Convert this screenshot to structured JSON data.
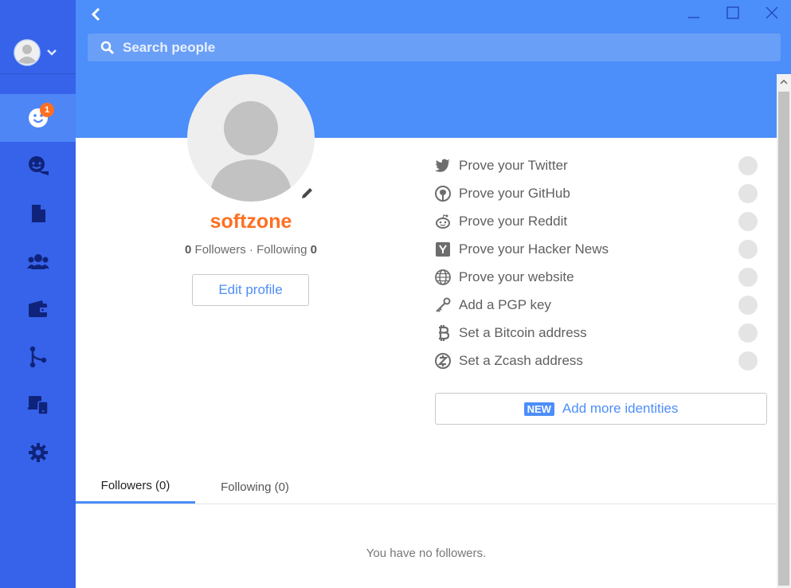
{
  "header": {
    "search_placeholder": "Search people",
    "accent_color": "#4c8efa"
  },
  "sidebar": {
    "badge_count": "1",
    "items": [
      {
        "name": "people",
        "active": true
      },
      {
        "name": "chat",
        "active": false
      },
      {
        "name": "files",
        "active": false
      },
      {
        "name": "teams",
        "active": false
      },
      {
        "name": "wallet",
        "active": false
      },
      {
        "name": "git",
        "active": false
      },
      {
        "name": "devices",
        "active": false
      },
      {
        "name": "settings",
        "active": false
      }
    ]
  },
  "profile": {
    "username": "softzone",
    "followers_count": "0",
    "followers_label": "Followers",
    "separator": "·",
    "following_label": "Following",
    "following_count": "0",
    "edit_label": "Edit profile"
  },
  "identities": [
    {
      "icon": "twitter-icon",
      "label": "Prove your Twitter"
    },
    {
      "icon": "github-icon",
      "label": "Prove your GitHub"
    },
    {
      "icon": "reddit-icon",
      "label": "Prove your Reddit"
    },
    {
      "icon": "hackernews-icon",
      "label": "Prove your Hacker News"
    },
    {
      "icon": "globe-icon",
      "label": "Prove your website"
    },
    {
      "icon": "key-icon",
      "label": "Add a PGP key"
    },
    {
      "icon": "bitcoin-icon",
      "label": "Set a Bitcoin address"
    },
    {
      "icon": "zcash-icon",
      "label": "Set a Zcash address"
    }
  ],
  "add_more": {
    "badge": "NEW",
    "label": "Add more identities"
  },
  "tabs": {
    "followers": "Followers (0)",
    "following": "Following (0)"
  },
  "empty_message": "You have no followers."
}
